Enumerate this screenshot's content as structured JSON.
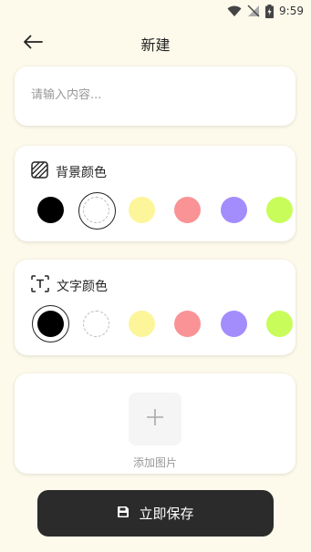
{
  "status_bar": {
    "time": "9:59"
  },
  "header": {
    "title": "新建"
  },
  "content": {
    "placeholder": "请输入内容..."
  },
  "background_color": {
    "title": "背景颜色",
    "colors": [
      "#000000",
      "#ffffff",
      "#fdf59a",
      "#f99395",
      "#a38cfc",
      "#c8fc5a"
    ],
    "selected_index": 1
  },
  "text_color": {
    "title": "文字颜色",
    "colors": [
      "#000000",
      "#ffffff",
      "#fdf59a",
      "#f99395",
      "#a38cfc",
      "#c8fc5a"
    ],
    "selected_index": 0
  },
  "image": {
    "add_label": "添加图片"
  },
  "save": {
    "label": "立即保存"
  }
}
